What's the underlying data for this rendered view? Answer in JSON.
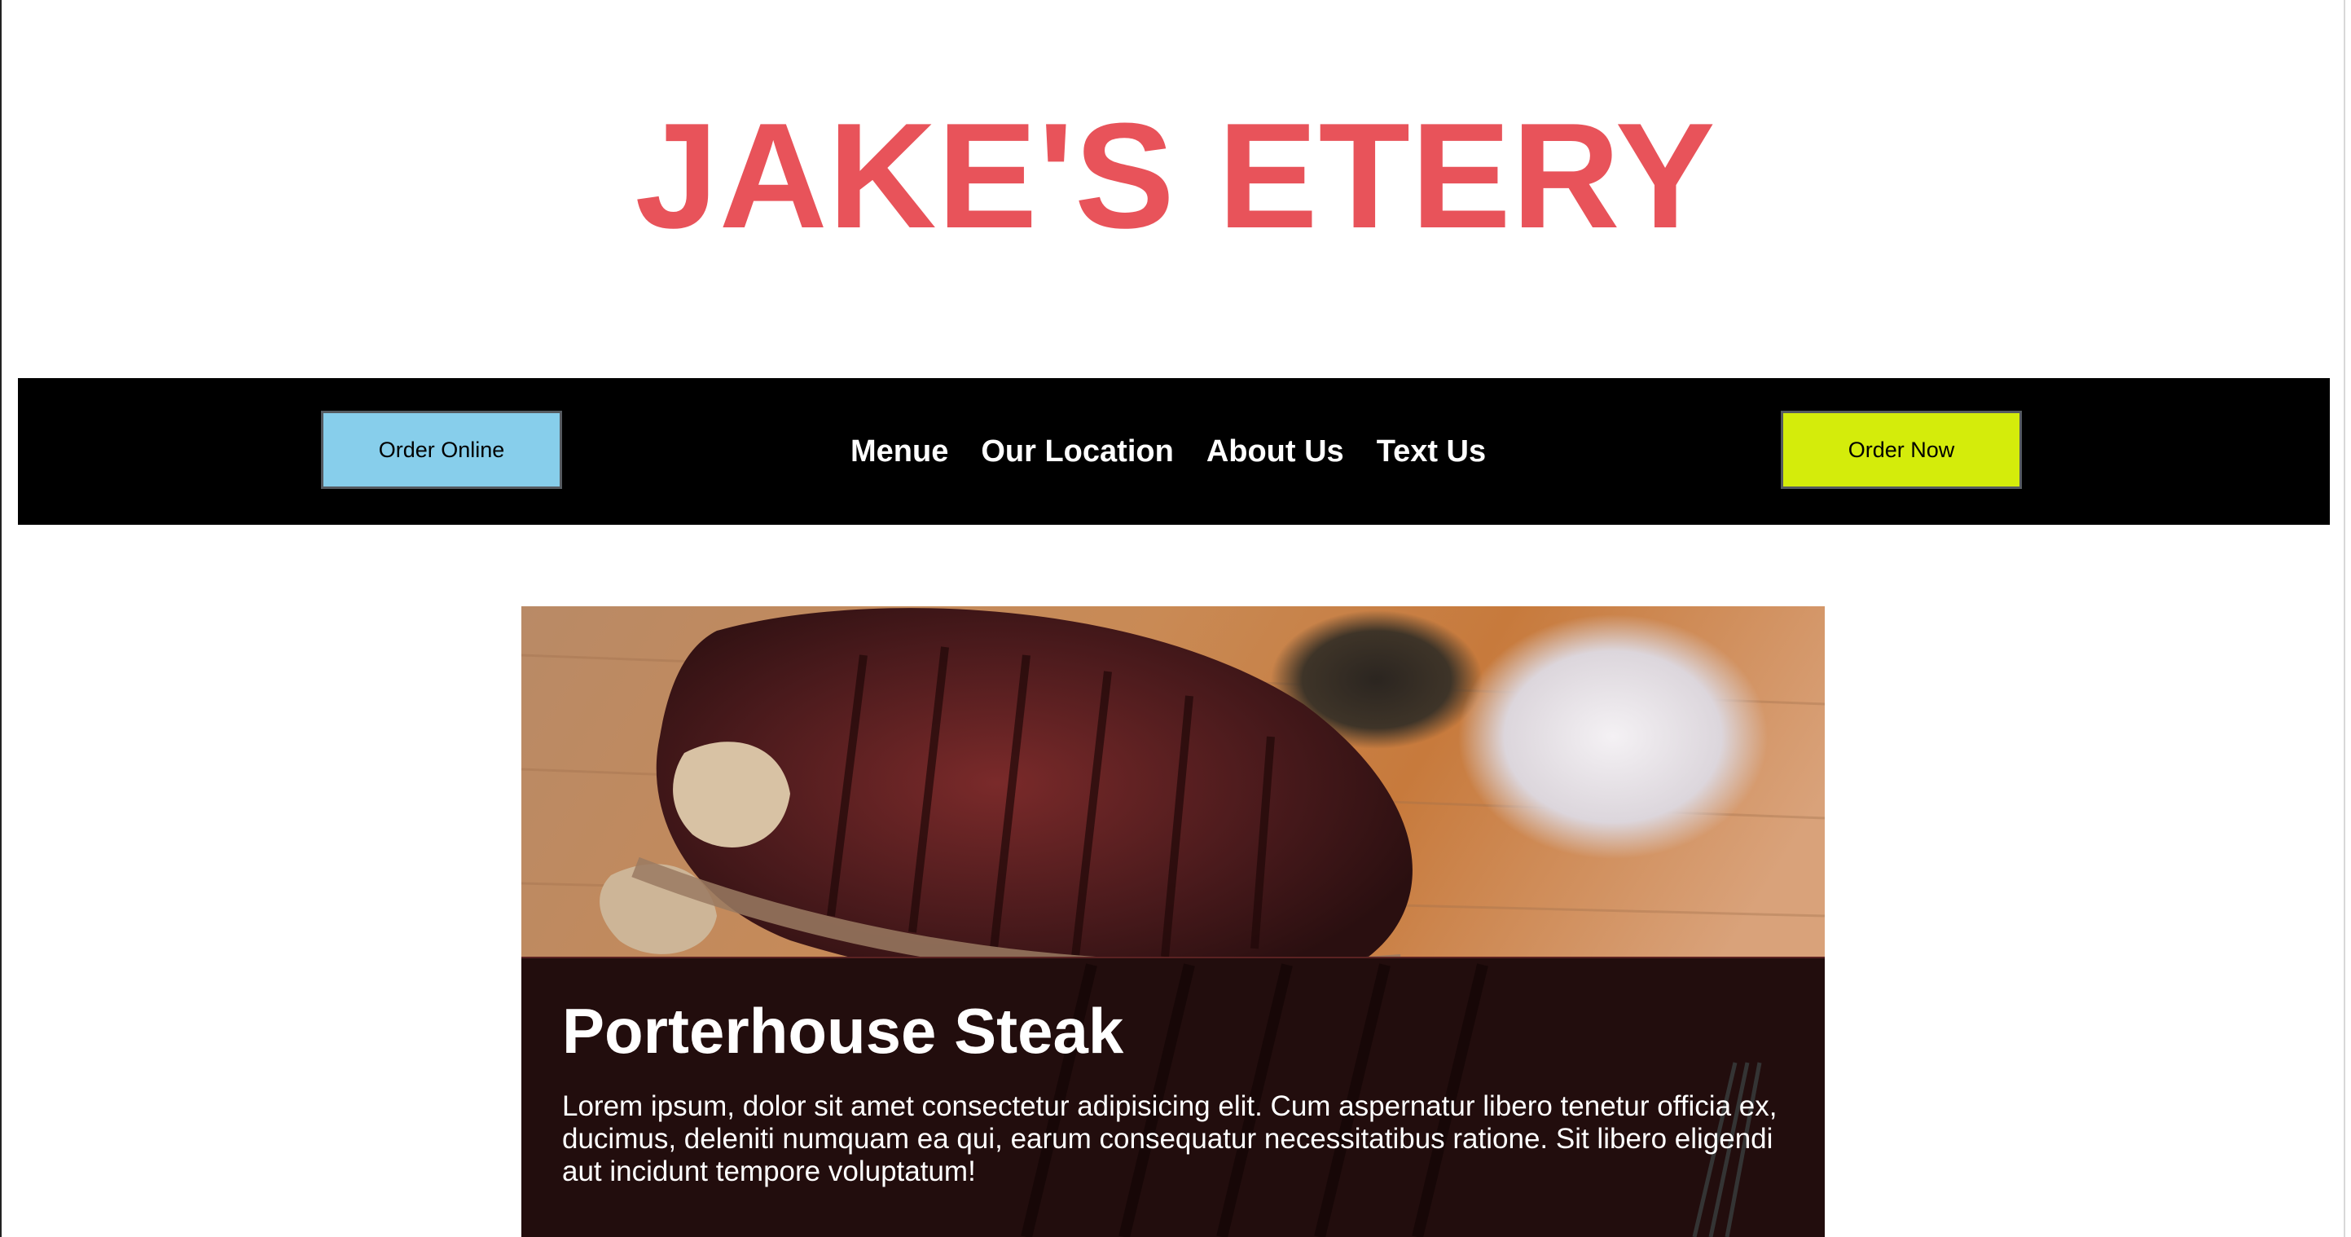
{
  "header": {
    "title": "JAKE'S ETERY",
    "title_color": "#e8535a"
  },
  "navbar": {
    "background": "#000000",
    "order_online_label": "Order Online",
    "order_online_color": "#87ceeb",
    "order_now_label": "Order Now",
    "order_now_color": "#d4ec0b",
    "links": [
      "Menue",
      "Our Location",
      "About Us",
      "Text Us"
    ]
  },
  "featured": {
    "title": "Porterhouse Steak",
    "description": "Lorem ipsum, dolor sit amet consectetur adipisicing elit. Cum aspernatur libero tenetur officia ex, ducimus, deleniti numquam ea qui, earum consequatur necessitatibus ratione. Sit libero eligendi aut incidunt tempore voluptatum!",
    "image_icon": "steak-photo"
  }
}
